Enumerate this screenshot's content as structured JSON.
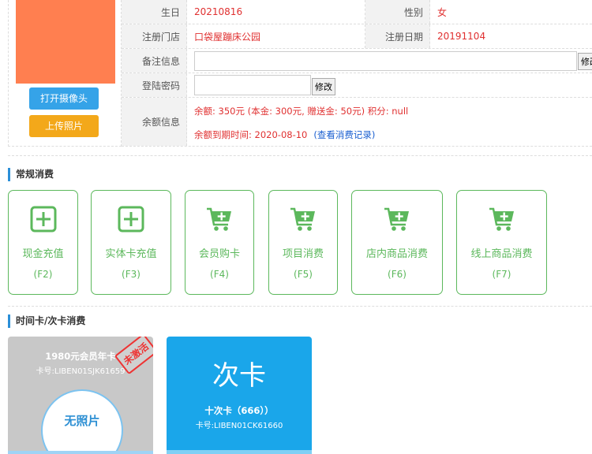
{
  "actions": {
    "open_camera": "打开摄像头",
    "upload_photo": "上传照片"
  },
  "info": {
    "birthday_label": "生日",
    "birthday": "20210816",
    "gender_label": "性别",
    "gender": "女",
    "store_label": "注册门店",
    "store": "口袋屋蹦床公园",
    "reg_date_label": "注册日期",
    "reg_date": "20191104",
    "note_label": "备注信息",
    "note_value": "",
    "note_btn": "修改",
    "password_label": "登陆密码",
    "password_value": "",
    "password_btn": "修改",
    "balance_label": "余额信息",
    "balance_line": "余额: 350元 (本金:  300元,  赠送金: 50元) 积分:  null",
    "expire_line": "余额到期时间:  2020-08-10",
    "records_link": "(查看消费记录)"
  },
  "sections": {
    "regular": "常规消费",
    "timecard": "时间卡/次卡消费"
  },
  "tiles": [
    {
      "label": "现金充值",
      "key": "(F2)",
      "icon": "plus-square-icon"
    },
    {
      "label": "实体卡充值",
      "key": "(F3)",
      "icon": "plus-square-icon"
    },
    {
      "label": "会员购卡",
      "key": "(F4)",
      "icon": "cart-plus-icon"
    },
    {
      "label": "项目消费",
      "key": "(F5)",
      "icon": "cart-plus-icon"
    },
    {
      "label": "店内商品消费",
      "key": "(F6)",
      "icon": "cart-plus-icon"
    },
    {
      "label": "线上商品消费",
      "key": "(F7)",
      "icon": "cart-plus-icon"
    }
  ],
  "cards": [
    {
      "title": "1980元会员年卡",
      "number": "卡号:LIBEN01SJK61659",
      "photo_text": "无照片",
      "stamp": "未激活"
    },
    {
      "big": "次卡",
      "title": "十次卡（666））",
      "number": "卡号:LIBEN01CK61660"
    }
  ],
  "colors": {
    "accent_green": "#5cb85c",
    "accent_blue": "#2b8fd8",
    "value_red": "#e03030",
    "photo_orange": "#ff7f50"
  }
}
